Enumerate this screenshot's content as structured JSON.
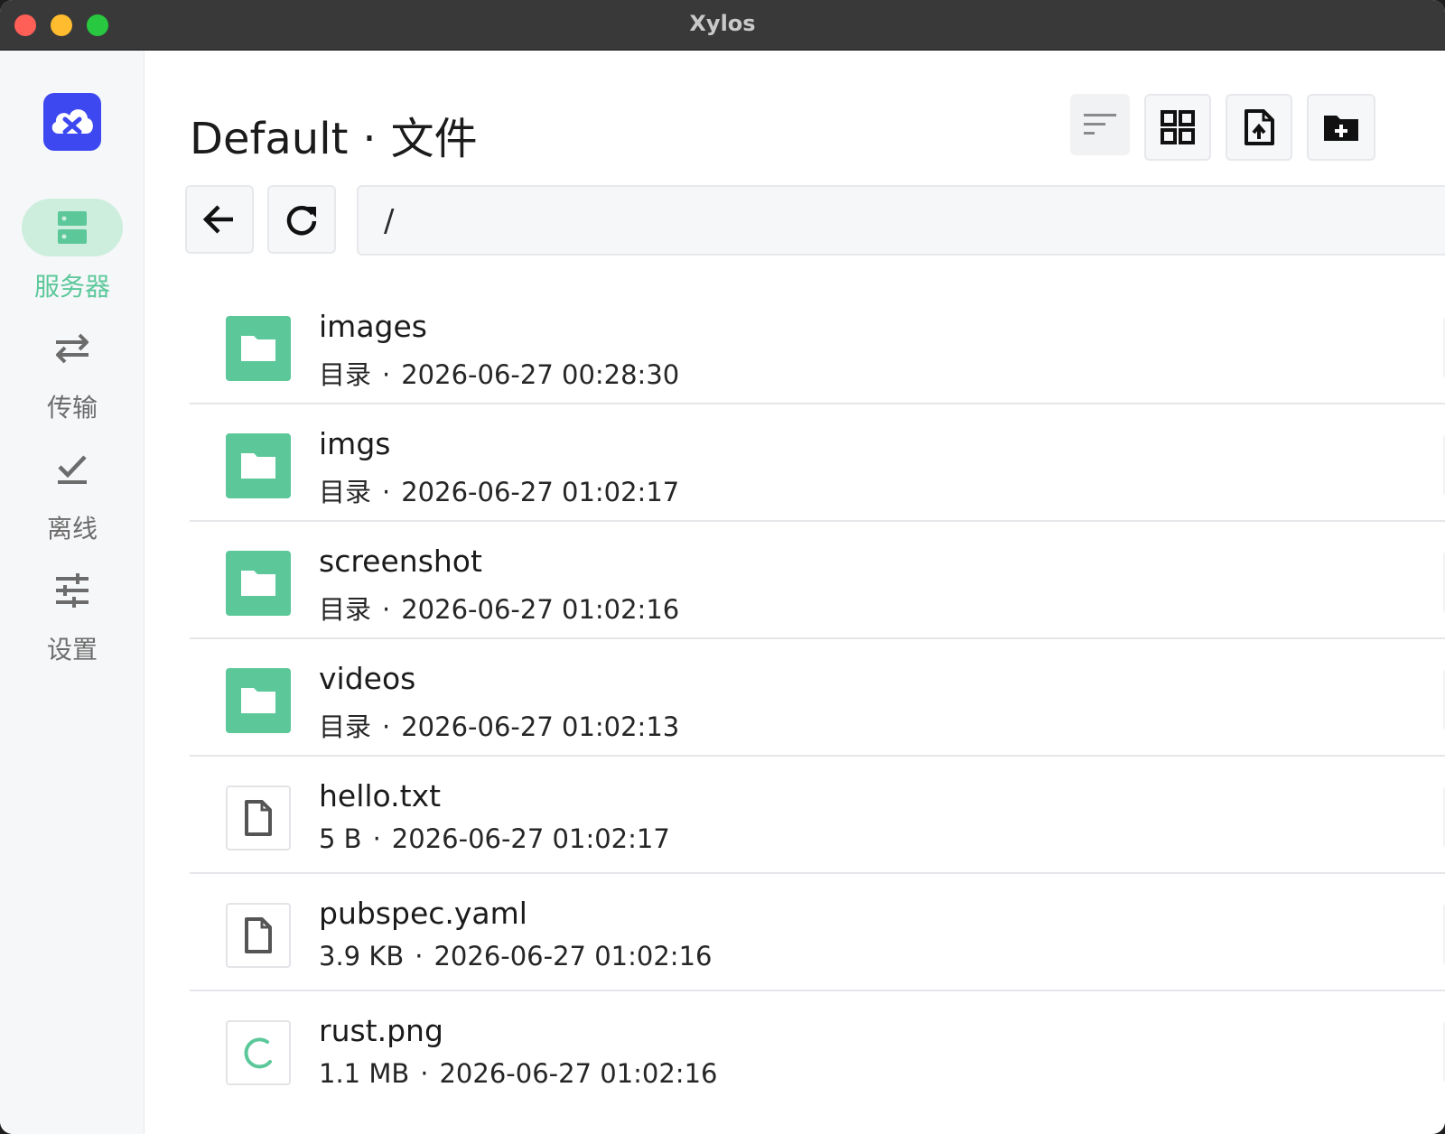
{
  "window": {
    "title": "Xylos"
  },
  "sidebar": {
    "items": [
      {
        "label": "服务器",
        "icon": "server-icon",
        "active": true
      },
      {
        "label": "传输",
        "icon": "transfer-arrows-icon",
        "active": false
      },
      {
        "label": "离线",
        "icon": "download-done-icon",
        "active": false
      },
      {
        "label": "设置",
        "icon": "sliders-icon",
        "active": false
      }
    ]
  },
  "header": {
    "server": "Default",
    "separator": "·",
    "section": "文件",
    "actions": [
      {
        "name": "sort",
        "icon": "sort-icon"
      },
      {
        "name": "grid-view",
        "icon": "grid-icon"
      },
      {
        "name": "upload-file",
        "icon": "upload-file-icon"
      },
      {
        "name": "new-folder",
        "icon": "new-folder-icon"
      }
    ]
  },
  "navigation": {
    "back_icon": "arrow-left-icon",
    "refresh_icon": "refresh-icon",
    "path": "/"
  },
  "files": [
    {
      "name": "images",
      "kind": "目录",
      "date": "2026-06-27 00:28:30",
      "type": "folder"
    },
    {
      "name": "imgs",
      "kind": "目录",
      "date": "2026-06-27 01:02:17",
      "type": "folder"
    },
    {
      "name": "screenshot",
      "kind": "目录",
      "date": "2026-06-27 01:02:16",
      "type": "folder"
    },
    {
      "name": "videos",
      "kind": "目录",
      "date": "2026-06-27 01:02:13",
      "type": "folder"
    },
    {
      "name": "hello.txt",
      "kind": "5 B",
      "date": "2026-06-27 01:02:17",
      "type": "file"
    },
    {
      "name": "pubspec.yaml",
      "kind": "3.9 KB",
      "date": "2026-06-27 01:02:16",
      "type": "file"
    },
    {
      "name": "rust.png",
      "kind": "1.1 MB",
      "date": "2026-06-27 01:02:16",
      "type": "loading"
    }
  ],
  "colors": {
    "accent": "#5cc89a",
    "accent_soft": "#cdeedd",
    "logo": "#3d48f0",
    "titlebar": "#393939"
  }
}
